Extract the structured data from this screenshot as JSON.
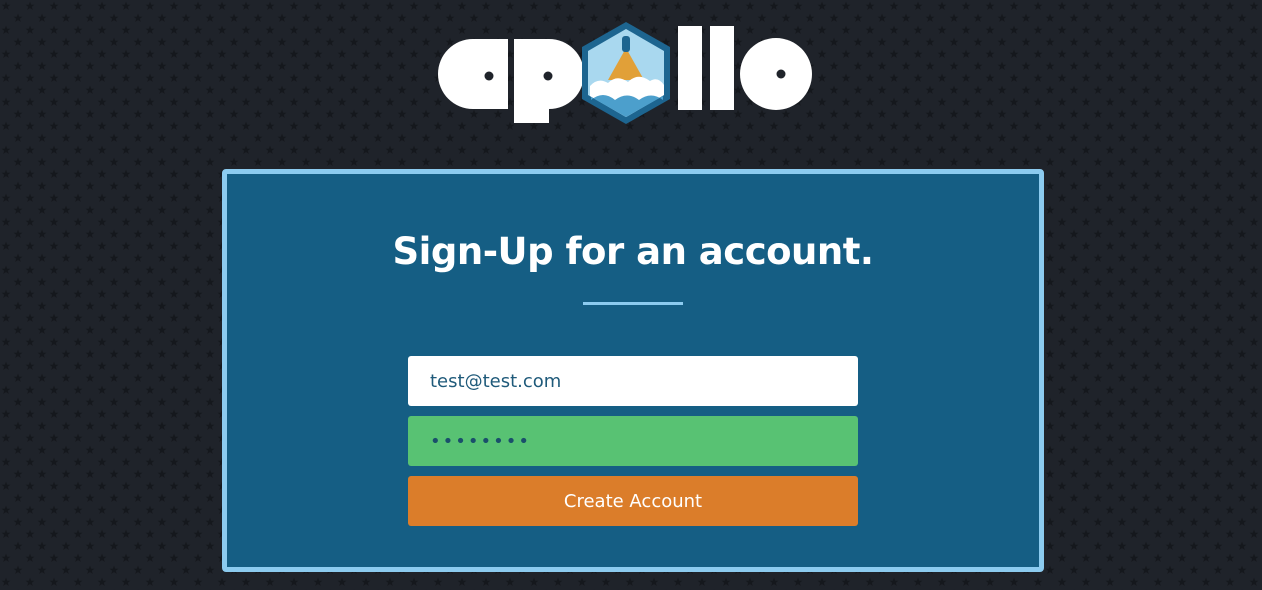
{
  "brand": {
    "logo_text": "apollo",
    "logo_icon": "rocket-hexagon-icon"
  },
  "form": {
    "title": "Sign-Up for an account.",
    "email_value": "test@test.com",
    "password_value": "password",
    "submit_label": "Create Account"
  },
  "colors": {
    "background": "#1f232a",
    "panel": "#155e84",
    "panel_border": "#8ccbef",
    "password_field": "#58c273",
    "button": "#db7d2a"
  }
}
